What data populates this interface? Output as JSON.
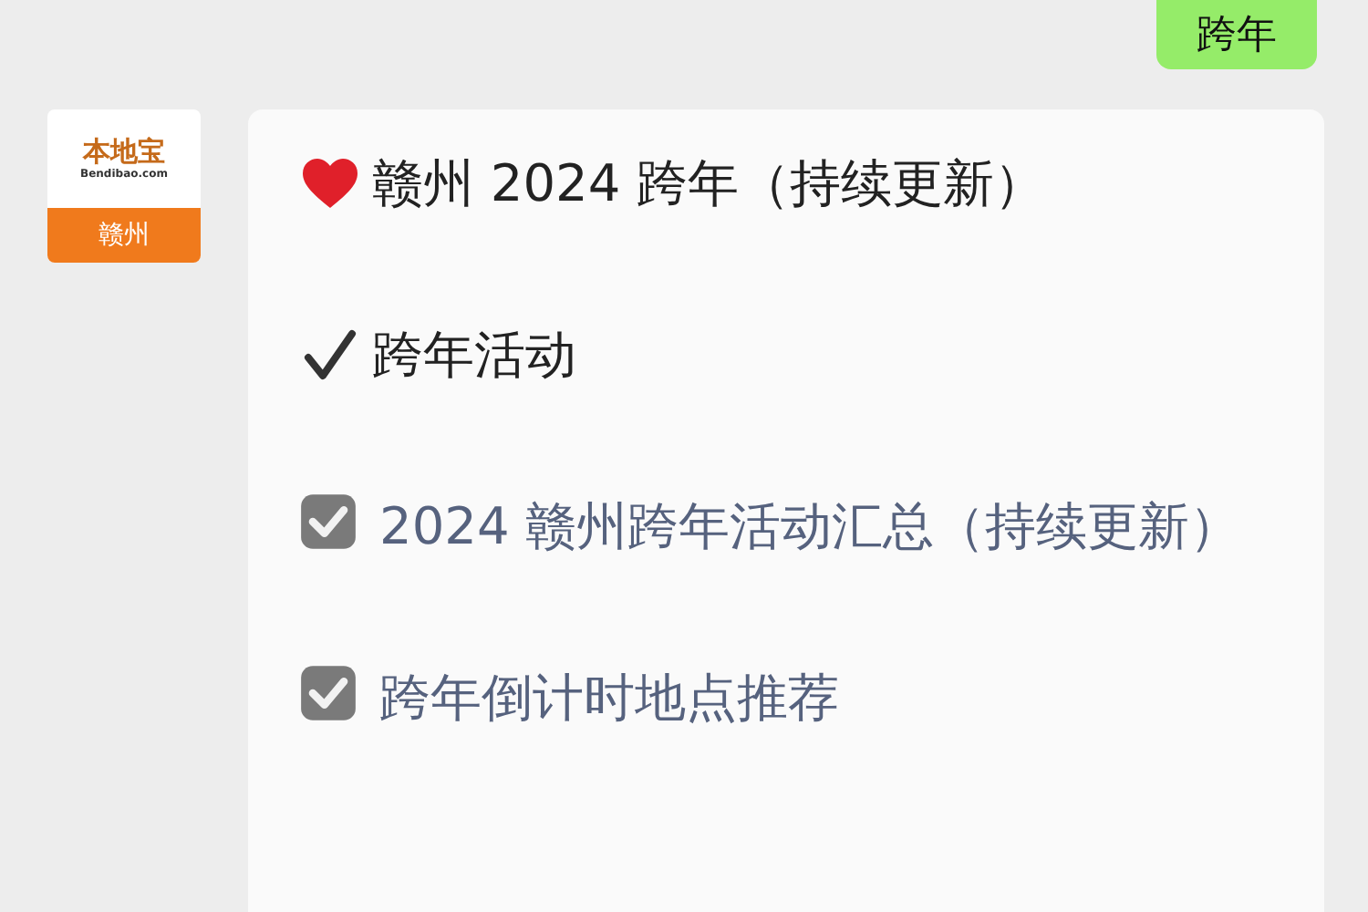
{
  "sent_message": {
    "text": "跨年"
  },
  "received_message": {
    "avatar": {
      "title": "本地宝",
      "subtitle": "Bendibao.com",
      "city": "赣州"
    },
    "lines": [
      {
        "kind": "heading",
        "text": "赣州 2024 跨年（持续更新）"
      },
      {
        "kind": "section",
        "text": "跨年活动"
      },
      {
        "kind": "link",
        "text": "2024 赣州跨年活动汇总（持续更新）"
      },
      {
        "kind": "link",
        "text": "跨年倒计时地点推荐"
      }
    ]
  }
}
